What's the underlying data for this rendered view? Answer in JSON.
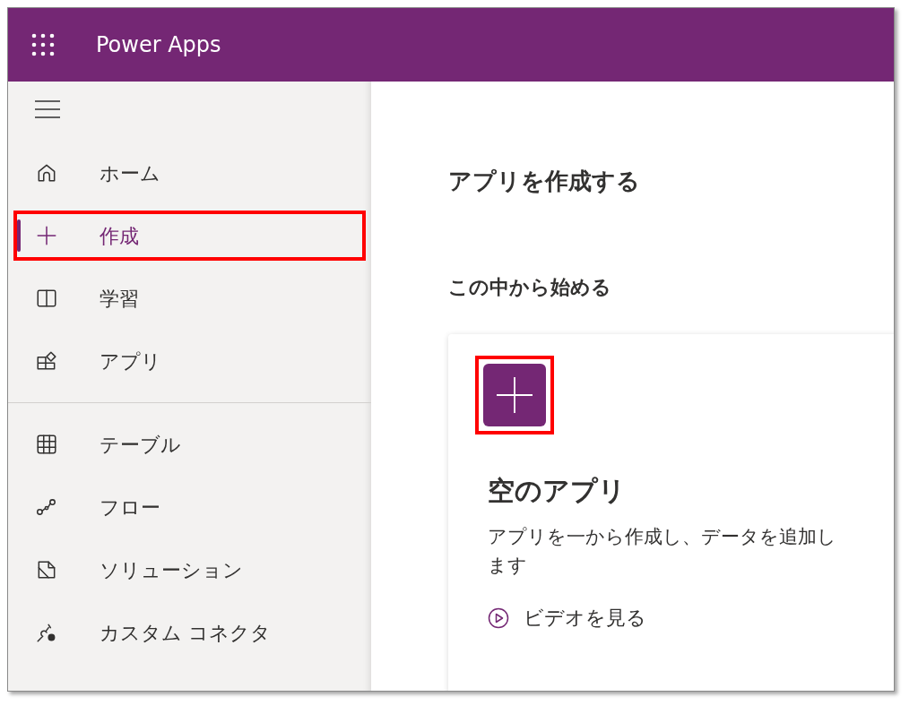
{
  "header": {
    "app_name": "Power Apps"
  },
  "sidebar": {
    "sections": [
      {
        "items": [
          {
            "label": "ホーム",
            "kind": "home",
            "selected": false,
            "highlighted": false
          },
          {
            "label": "作成",
            "kind": "plus",
            "selected": true,
            "highlighted": true
          },
          {
            "label": "学習",
            "kind": "book",
            "selected": false,
            "highlighted": false
          },
          {
            "label": "アプリ",
            "kind": "apps",
            "selected": false,
            "highlighted": false
          }
        ]
      },
      {
        "items": [
          {
            "label": "テーブル",
            "kind": "table",
            "selected": false,
            "highlighted": false
          },
          {
            "label": "フロー",
            "kind": "flow",
            "selected": false,
            "highlighted": false
          },
          {
            "label": "ソリューション",
            "kind": "solution",
            "selected": false,
            "highlighted": false
          },
          {
            "label": "カスタム コネクタ",
            "kind": "connector",
            "selected": false,
            "highlighted": false
          }
        ]
      }
    ]
  },
  "main": {
    "title": "アプリを作成する",
    "section_title": "この中から始める",
    "cards": [
      {
        "title": "空のアプリ",
        "description": "アプリを一から作成し、データを追加します",
        "link": "ビデオを見る",
        "highlighted": true
      }
    ]
  }
}
